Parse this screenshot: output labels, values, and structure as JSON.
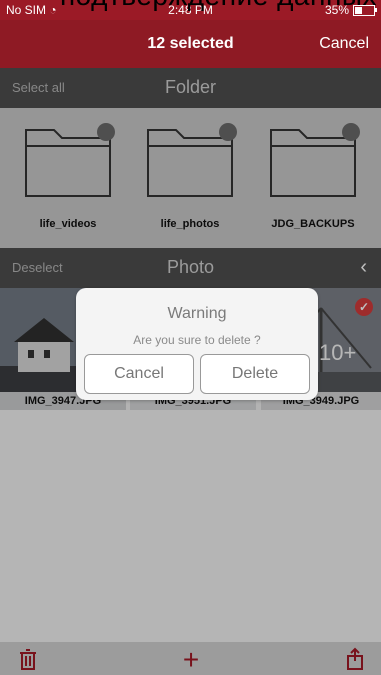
{
  "overlay_caption": "подтверждение данных",
  "status_bar": {
    "carrier": "No SIM",
    "time": "2:48 PM",
    "battery": "35%"
  },
  "nav": {
    "title": "12 selected",
    "cancel_label": "Cancel"
  },
  "folder_section": {
    "action_label": "Select all",
    "title": "Folder"
  },
  "folders": [
    {
      "label": "life_videos"
    },
    {
      "label": "life_photos"
    },
    {
      "label": "JDG_BACKUPS"
    }
  ],
  "photo_section": {
    "action_label": "Deselect",
    "title": "Photo"
  },
  "photos": [
    {
      "caption": "IMG_3947.JPG"
    },
    {
      "caption": "IMG_3951.JPG"
    },
    {
      "caption": "IMG_3949.JPG",
      "count_label": "10+",
      "selected_mark": "✓"
    }
  ],
  "dialog": {
    "title": "Warning",
    "message": "Are you sure to delete ?",
    "cancel_label": "Cancel",
    "delete_label": "Delete"
  },
  "colors": {
    "accent": "#8e1a24"
  }
}
